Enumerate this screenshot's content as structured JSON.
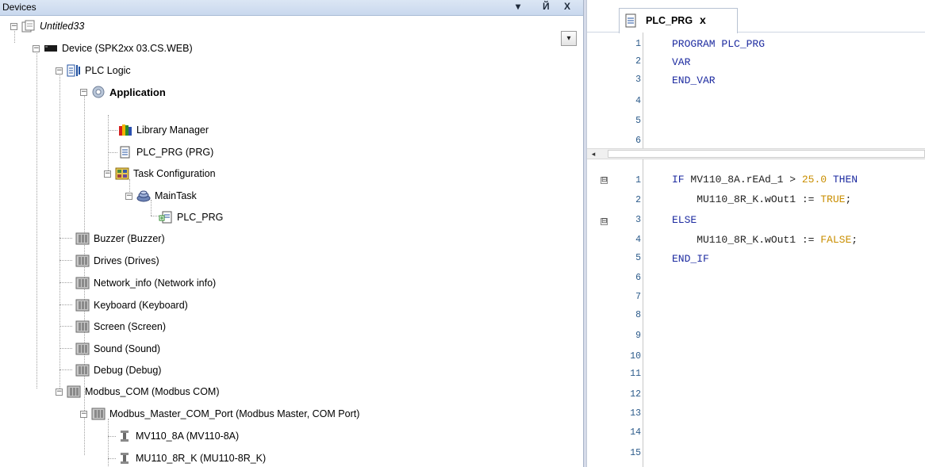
{
  "devices_panel": {
    "title": "Devices",
    "controls": {
      "dropdown": "▾",
      "pin": "Й",
      "close": "X"
    },
    "scroll_arrow": "▾"
  },
  "tree": [
    {
      "label": "Untitled33",
      "italic": true,
      "icon": "project-icon"
    },
    {
      "label": "Device (SPK2xx 03.CS.WEB)",
      "icon": "device-icon"
    },
    {
      "label": "PLC Logic",
      "icon": "plc-logic-icon"
    },
    {
      "label": "Application",
      "bold": true,
      "icon": "application-gear-icon"
    },
    {
      "label": "Library Manager",
      "icon": "library-books-icon"
    },
    {
      "label": "PLC_PRG (PRG)",
      "icon": "document-icon"
    },
    {
      "label": "Task Configuration",
      "icon": "task-configuration-icon"
    },
    {
      "label": "MainTask",
      "icon": "task-icon"
    },
    {
      "label": "PLC_PRG",
      "icon": "program-call-icon"
    },
    {
      "label": "Buzzer (Buzzer)",
      "icon": "module-icon"
    },
    {
      "label": "Drives (Drives)",
      "icon": "module-icon"
    },
    {
      "label": "Network_info (Network info)",
      "icon": "module-icon"
    },
    {
      "label": "Keyboard (Keyboard)",
      "icon": "module-icon"
    },
    {
      "label": "Screen (Screen)",
      "icon": "module-icon"
    },
    {
      "label": "Sound (Sound)",
      "icon": "module-icon"
    },
    {
      "label": "Debug (Debug)",
      "icon": "module-icon"
    },
    {
      "label": "Modbus_COM (Modbus COM)",
      "icon": "module-icon"
    },
    {
      "label": "Modbus_Master_COM_Port (Modbus Master, COM Port)",
      "icon": "module-icon"
    },
    {
      "label": "MV110_8A (MV110-8A)",
      "icon": "slave-device-icon"
    },
    {
      "label": "MU110_8R_K (MU110-8R_K)",
      "icon": "slave-device-icon"
    }
  ],
  "editor": {
    "tab": {
      "label": "PLC_PRG",
      "close": "x"
    },
    "declaration": {
      "line_numbers": [
        "1",
        "2",
        "3",
        "4",
        "5",
        "6"
      ],
      "lines": [
        "PROGRAM PLC_PRG",
        "VAR",
        "END_VAR",
        "",
        "",
        ""
      ]
    },
    "hscroll_left": "◂",
    "body": {
      "line_numbers": [
        "1",
        "2",
        "3",
        "4",
        "5",
        "6",
        "7",
        "8",
        "9",
        "10",
        "11",
        "12",
        "13",
        "14",
        "15"
      ],
      "fold_markers": {
        "line1": "⊟",
        "line3": "⊟"
      },
      "lines": {
        "l1_kw_if": "IF",
        "l1_id": " MV110_8A.rEAd_1 > ",
        "l1_num": "25.0",
        "l1_kw_then": " THEN",
        "l2_id": "    MU110_8R_K.wOut1 := ",
        "l2_val": "TRUE",
        "l2_end": ";",
        "l3_kw": "ELSE",
        "l4_id": "    MU110_8R_K.wOut1 := ",
        "l4_val": "FALSE",
        "l4_end": ";",
        "l5_kw": "END_IF"
      }
    }
  }
}
